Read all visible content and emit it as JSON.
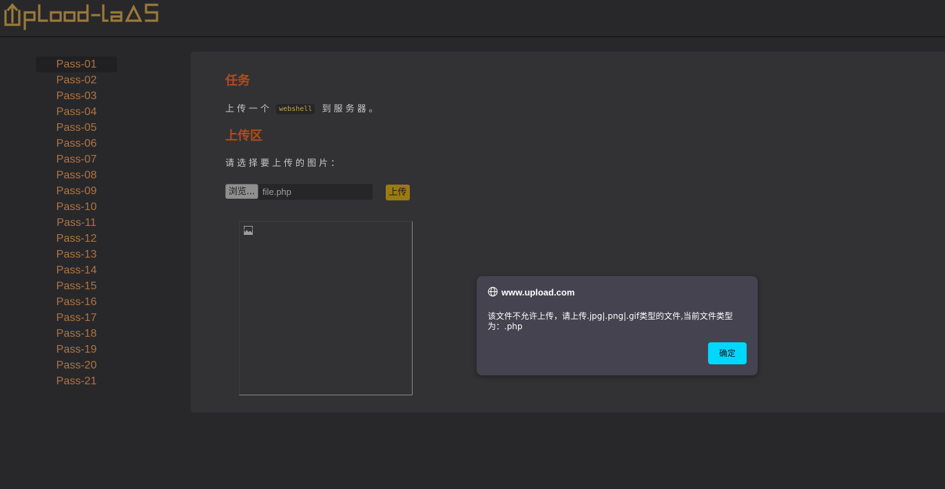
{
  "header": {
    "logo_text": "Upload-labs",
    "logo_icon": "upload-labs-logo"
  },
  "sidebar": {
    "items": [
      {
        "label": "Pass-01",
        "active": true
      },
      {
        "label": "Pass-02"
      },
      {
        "label": "Pass-03"
      },
      {
        "label": "Pass-04"
      },
      {
        "label": "Pass-05"
      },
      {
        "label": "Pass-06"
      },
      {
        "label": "Pass-07"
      },
      {
        "label": "Pass-08"
      },
      {
        "label": "Pass-09"
      },
      {
        "label": "Pass-10"
      },
      {
        "label": "Pass-11"
      },
      {
        "label": "Pass-12"
      },
      {
        "label": "Pass-13"
      },
      {
        "label": "Pass-14"
      },
      {
        "label": "Pass-15"
      },
      {
        "label": "Pass-16"
      },
      {
        "label": "Pass-17"
      },
      {
        "label": "Pass-18"
      },
      {
        "label": "Pass-19"
      },
      {
        "label": "Pass-20"
      },
      {
        "label": "Pass-21"
      }
    ]
  },
  "main": {
    "task_title": "任务",
    "task_prefix": "上传一个",
    "task_code": "webshell",
    "task_suffix": "到服务器。",
    "upload_title": "上传区",
    "upload_prompt": "请选择要上传的图片：",
    "browse_label": "浏览...",
    "file_name": "file.php",
    "upload_label": "上传",
    "preview_icon": "broken-image-icon"
  },
  "dialog": {
    "origin": "www.upload.com",
    "message": "该文件不允许上传，请上传.jpg|.png|.gif类型的文件,当前文件类型为：.php",
    "ok_label": "确定",
    "globe_icon": "globe-icon"
  },
  "colors": {
    "background": "#28282a",
    "panel": "#323235",
    "accent_orange": "#b04e1a",
    "nav_text": "#b07442",
    "upload_button": "#9a7a12",
    "dialog_bg": "#45434f",
    "dialog_button": "#00d7ff"
  }
}
